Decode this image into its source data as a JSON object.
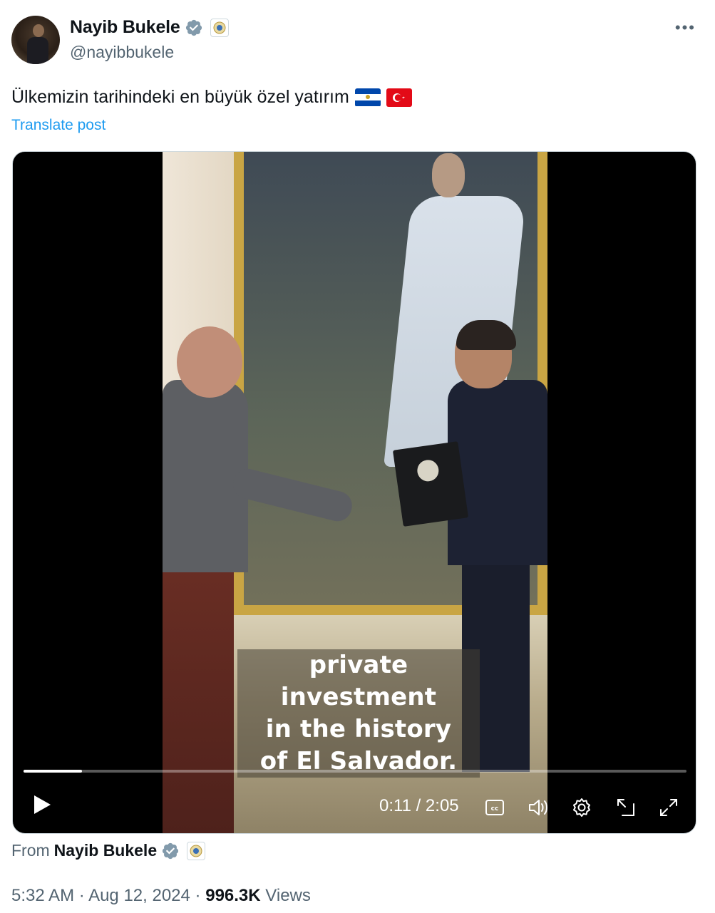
{
  "author": {
    "name": "Nayib Bukele",
    "handle": "@nayibbukele"
  },
  "post": {
    "text": "Ülkemizin tarihindeki en büyük özel yatırım",
    "flags": [
      "el-salvador-flag",
      "turkey-flag"
    ],
    "translate_label": "Translate post"
  },
  "video": {
    "caption_lines": [
      "private investment",
      "in the history",
      "of El Salvador."
    ],
    "progress": 0.088,
    "time": "0:11 / 2:05",
    "controls": [
      "play-icon",
      "captions-icon",
      "volume-icon",
      "settings-icon",
      "picture-in-picture-icon",
      "fullscreen-icon"
    ]
  },
  "from": {
    "prefix": "From",
    "name": "Nayib Bukele"
  },
  "meta": {
    "time": "5:32 AM",
    "date": "Aug 12, 2024",
    "views": "996.3K",
    "views_label": "Views",
    "separator": "·"
  },
  "colors": {
    "link": "#1d9bf0",
    "verified": "#829aab",
    "muted": "#536471"
  }
}
